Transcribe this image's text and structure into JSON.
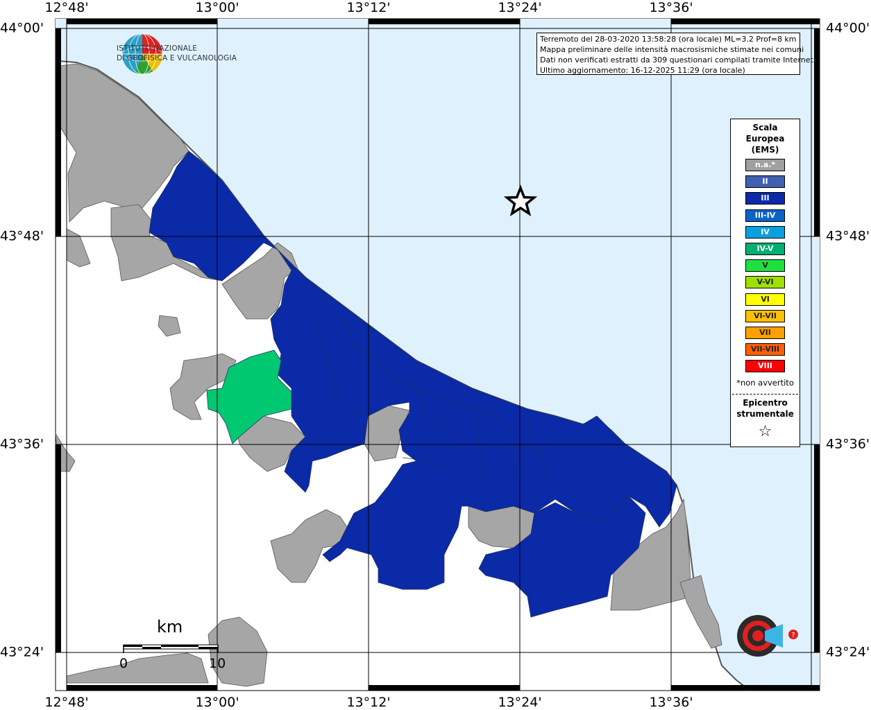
{
  "longitude_labels": [
    "12°48'",
    "13°00'",
    "13°12'",
    "13°24'",
    "13°36'"
  ],
  "latitude_labels": [
    "44°00'",
    "43°48'",
    "43°36'",
    "43°24'"
  ],
  "institute": {
    "line1": "ISTITUTO NAZIONALE",
    "line2": "DI GEOFISICA E VULCANOLOGIA"
  },
  "info_box": {
    "line1": "Terremoto del 28-03-2020 13:58:28 (ora locale) ML=3.2 Prof=8 km",
    "line2": "Mappa preliminare delle intensità macrosismiche stimate nei comuni",
    "line3": "Dati non verificati estratti da 309 questionari compilati tramite Internet.",
    "line4": "Ultimo aggiornamento: 16-12-2025 11:29 (ora locale)"
  },
  "legend": {
    "title": "Scala\nEuropea\n(EMS)",
    "items": [
      {
        "label": "n.a.*",
        "color": "#a0a0a0"
      },
      {
        "label": "II",
        "color": "#4060b0"
      },
      {
        "label": "III",
        "color": "#0a2aa8"
      },
      {
        "label": "III-IV",
        "color": "#0a64c8"
      },
      {
        "label": "IV",
        "color": "#0aa0e0"
      },
      {
        "label": "IV-V",
        "color": "#00b070"
      },
      {
        "label": "V",
        "color": "#20e040"
      },
      {
        "label": "V-VI",
        "color": "#a0e000"
      },
      {
        "label": "VI",
        "color": "#ffff00"
      },
      {
        "label": "VI-VII",
        "color": "#ffc000"
      },
      {
        "label": "VII",
        "color": "#ffa000"
      },
      {
        "label": "VII-VIII",
        "color": "#ff6000"
      },
      {
        "label": "VIII",
        "color": "#ff0000"
      }
    ],
    "note": "*non avvertito",
    "epicenter_label": "Epicentro\nstrumentale",
    "epicenter_symbol": "☆"
  },
  "scale_bar": {
    "unit": "km",
    "start": "0",
    "end": "10"
  },
  "map_colors": {
    "sea": "#dff1fd",
    "land": "#ffffff",
    "na": "#a6a6a6",
    "intensity_iii": "#0a2aa8",
    "intensity_iv_v": "#00c870"
  },
  "epicenter": {
    "lat": 43.84,
    "lon": 13.4
  }
}
